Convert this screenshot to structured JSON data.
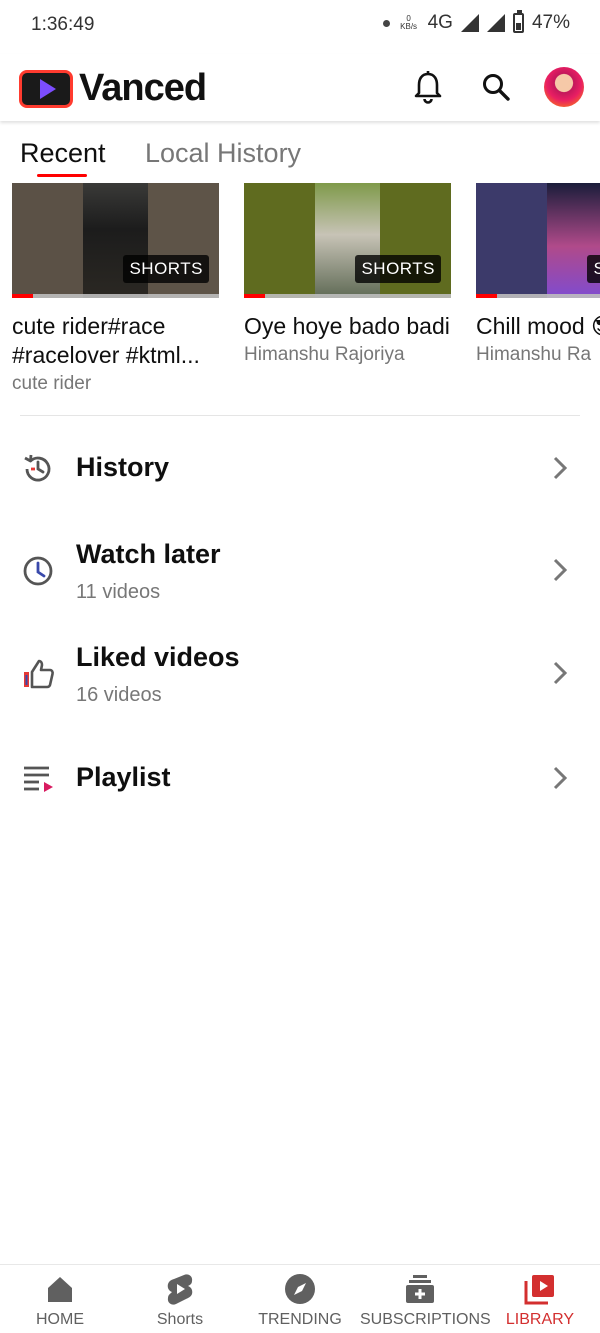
{
  "status_bar": {
    "time": "1:36:49",
    "net_speed_value": "0",
    "net_speed_unit": "KB/s",
    "network": "4G",
    "battery": "47%",
    "battery_level": 0.47
  },
  "header": {
    "app_name": "Vanced",
    "icons": [
      "notifications-bell-icon",
      "search-icon",
      "account-avatar"
    ]
  },
  "tabs": [
    {
      "label": "Recent",
      "active": true
    },
    {
      "label": "Local History",
      "active": false
    }
  ],
  "recent_videos": [
    {
      "title": "cute rider#race #racelover #ktml...",
      "channel": "cute rider",
      "badge": "SHORTS",
      "watched_fraction": 0.1
    },
    {
      "title": "Oye hoye bado badi",
      "channel": "Himanshu Rajoriya",
      "badge": "SHORTS",
      "watched_fraction": 0.1
    },
    {
      "title": "Chill mood 😎",
      "channel": "Himanshu Ra",
      "badge": "SHORTS",
      "watched_fraction": 0.1
    }
  ],
  "library_items": [
    {
      "title": "History",
      "subtitle": "",
      "icon": "history-icon"
    },
    {
      "title": "Watch later",
      "subtitle": "11 videos",
      "icon": "clock-icon"
    },
    {
      "title": "Liked videos",
      "subtitle": "16 videos",
      "icon": "thumbs-up-icon"
    },
    {
      "title": "Playlist",
      "subtitle": "",
      "icon": "playlist-icon"
    }
  ],
  "bottom_nav": [
    {
      "label": "HOME",
      "icon": "home-icon",
      "active": false
    },
    {
      "label": "Shorts",
      "icon": "shorts-icon",
      "active": false
    },
    {
      "label": "TRENDING",
      "icon": "compass-icon",
      "active": false
    },
    {
      "label": "SUBSCRIPTIONS",
      "icon": "subscriptions-icon",
      "active": false
    },
    {
      "label": "LIBRARY",
      "icon": "library-icon",
      "active": true
    }
  ],
  "colors": {
    "accent": "#ff0000",
    "active_nav": "#d32f2f",
    "secondary_text": "#777777"
  }
}
